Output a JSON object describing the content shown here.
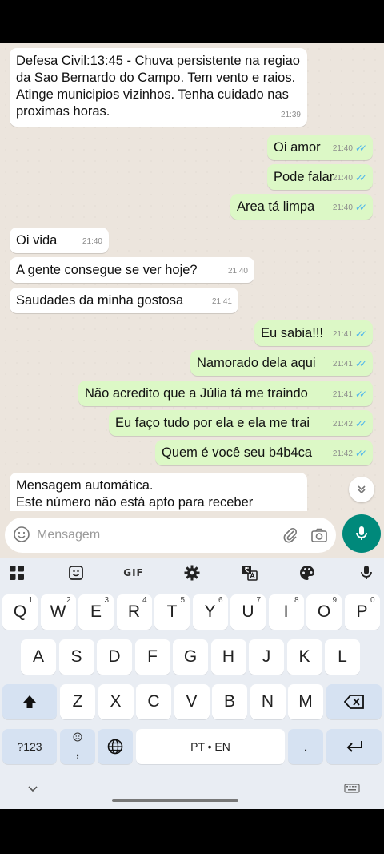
{
  "chat": {
    "messages": [
      {
        "dir": "in",
        "text": "Defesa Civil:13:45 - Chuva persistente na regiao\nda Sao Bernardo do Campo. Tem vento e raios.\nAtinge municipios vizinhos. Tenha cuidado nas\nproximas horas.",
        "time": "21:39"
      },
      {
        "dir": "out",
        "text": "Oi amor",
        "time": "21:40"
      },
      {
        "dir": "out",
        "text": "Pode falar",
        "time": "21:40"
      },
      {
        "dir": "out",
        "text": "Area tá limpa",
        "time": "21:40"
      },
      {
        "dir": "in",
        "text": "Oi vida",
        "time": "21:40"
      },
      {
        "dir": "in",
        "text": "A gente consegue se ver hoje?",
        "time": "21:40"
      },
      {
        "dir": "in",
        "text": "Saudades da minha gostosa",
        "time": "21:41"
      },
      {
        "dir": "out",
        "text": "Eu sabia!!!",
        "time": "21:41"
      },
      {
        "dir": "out",
        "text": "Namorado dela aqui",
        "time": "21:41"
      },
      {
        "dir": "out",
        "text": "Não acredito que a Júlia tá me traindo",
        "time": "21:41"
      },
      {
        "dir": "out",
        "text": "Eu faço tudo por ela e ela me trai",
        "time": "21:42"
      },
      {
        "dir": "out",
        "text": "Quem é você seu b4b4ca",
        "time": "21:42"
      },
      {
        "dir": "in",
        "text": "Mensagem automática.\nEste número não está apto para receber",
        "time": ""
      }
    ]
  },
  "composer": {
    "placeholder": "Mensagem"
  },
  "keyboard": {
    "toolbar": {
      "gif_label": "GIF"
    },
    "row1": [
      {
        "k": "Q",
        "h": "1"
      },
      {
        "k": "W",
        "h": "2"
      },
      {
        "k": "E",
        "h": "3"
      },
      {
        "k": "R",
        "h": "4"
      },
      {
        "k": "T",
        "h": "5"
      },
      {
        "k": "Y",
        "h": "6"
      },
      {
        "k": "U",
        "h": "7"
      },
      {
        "k": "I",
        "h": "8"
      },
      {
        "k": "O",
        "h": "9"
      },
      {
        "k": "P",
        "h": "0"
      }
    ],
    "row2": [
      "A",
      "S",
      "D",
      "F",
      "G",
      "H",
      "J",
      "K",
      "L"
    ],
    "row3": [
      "Z",
      "X",
      "C",
      "V",
      "B",
      "N",
      "M"
    ],
    "symbols_label": "?123",
    "comma_label": ",",
    "space_label": "PT • EN",
    "period_label": "."
  },
  "colors": {
    "incoming": "#ffffff",
    "outgoing": "#dcf8c6",
    "mic_button": "#00897b",
    "read_ticks": "#4fb6ec"
  }
}
